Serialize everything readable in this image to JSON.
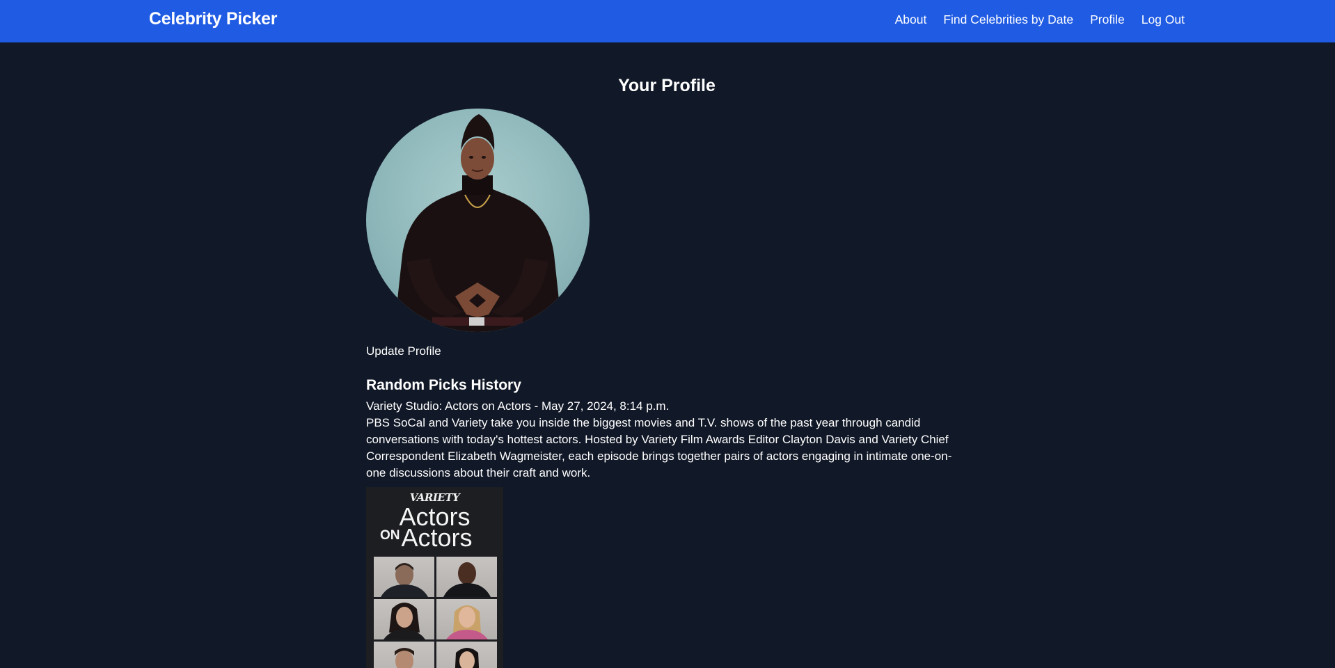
{
  "nav": {
    "brand": "Celebrity Picker",
    "links": [
      "About",
      "Find Celebrities by Date",
      "Profile",
      "Log Out"
    ]
  },
  "page": {
    "title": "Your Profile",
    "update_profile_label": "Update Profile"
  },
  "history": {
    "title": "Random Picks History",
    "entries": [
      {
        "heading": "Variety Studio: Actors on Actors - May 27, 2024, 8:14 p.m.",
        "description": "PBS SoCal and Variety take you inside the biggest movies and T.V. shows of the past year through candid conversations with today's hottest actors. Hosted by Variety Film Awards Editor Clayton Davis and Variety Chief Correspondent Elizabeth Wagmeister, each episode brings together pairs of actors engaging in intimate one-on-one discussions about their craft and work.",
        "poster": {
          "brand": "VARIETY",
          "line1": "Actors",
          "line2_small": "ON",
          "line2": "Actors"
        }
      }
    ]
  },
  "colors": {
    "navbar": "#1f5be3",
    "background": "#111827",
    "text": "#ffffff"
  }
}
